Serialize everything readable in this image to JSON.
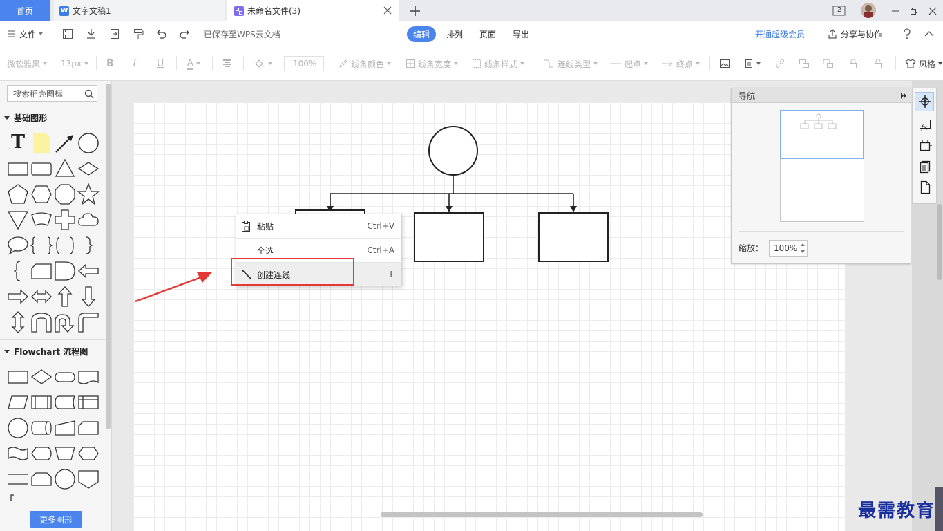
{
  "tabs": {
    "home": "首页",
    "doc": "文字文稿1",
    "flow": "未命名文件(3)",
    "doc_icon": "W"
  },
  "window": {
    "badge": "2"
  },
  "menubar": {
    "file": "文件",
    "saved": "已保存至WPS云文档",
    "edit": "编辑",
    "arrange": "排列",
    "page": "页面",
    "export": "导出",
    "vip": "开通超级会员",
    "share": "分享与协作"
  },
  "toolbar": {
    "font": "微软雅黑",
    "size": "13px",
    "bold": "B",
    "italic": "I",
    "underline": "U",
    "fontcolor": "A",
    "opacity": "100%",
    "line_color": "线条颜色",
    "line_width": "线条宽度",
    "line_style": "线条样式",
    "conn_type": "连线类型",
    "start": "起点",
    "end": "终点",
    "style": "风格"
  },
  "sidebar": {
    "search_placeholder": "搜索稻壳图标",
    "basic": "基础图形",
    "flowchart": "Flowchart 流程图",
    "more": "更多图形",
    "text_glyph": "T"
  },
  "navigator": {
    "title": "导航",
    "zoom_label": "缩放：",
    "zoom_value": "100%"
  },
  "context_menu": {
    "items": [
      {
        "label": "粘贴",
        "shortcut": "Ctrl+V"
      },
      {
        "label": "全选",
        "shortcut": "Ctrl+A"
      },
      {
        "label": "创建连线",
        "shortcut": "L"
      }
    ]
  },
  "watermark": "最需教育",
  "colors": {
    "accent": "#4a85ee",
    "highlight_box": "#e53935",
    "watermark": "#1a2f9e"
  }
}
